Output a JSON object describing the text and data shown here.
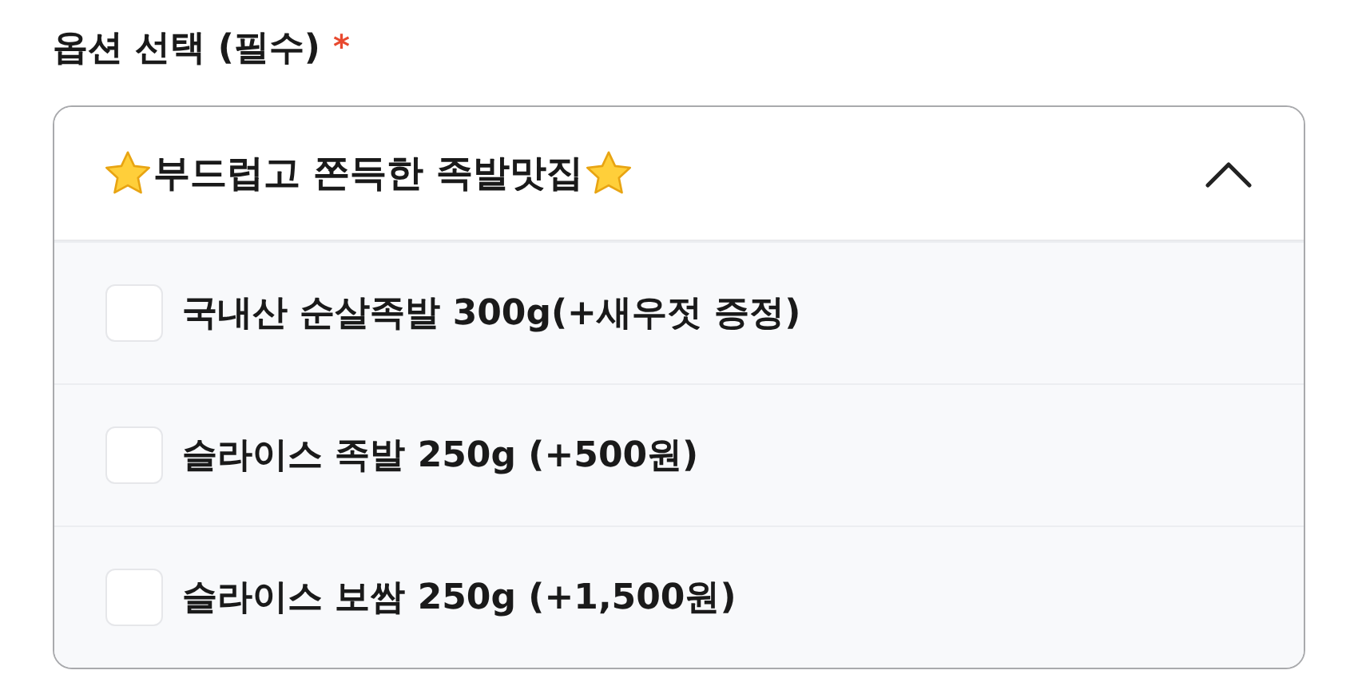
{
  "field": {
    "label": "옵션 선택 (필수)",
    "required_mark": "*"
  },
  "dropdown": {
    "title": "부드럽고 쫀득한 족발맛집",
    "expanded": true,
    "options": [
      {
        "label": "국내산 순살족발 300g(+새우젓 증정)",
        "checked": false
      },
      {
        "label": "슬라이스 족발 250g (+500원)",
        "checked": false
      },
      {
        "label": "슬라이스 보쌈 250g (+1,500원)",
        "checked": false
      }
    ]
  }
}
